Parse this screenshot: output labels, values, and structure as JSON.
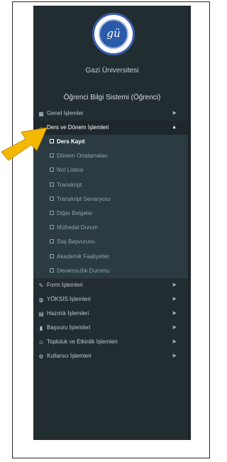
{
  "university": {
    "name": "Gazi Üniversitesi",
    "logo_monogram": "gü"
  },
  "panel_title": "Öğrenci Bilgi Sistemi (Öğrenci)",
  "colors": {
    "sidebar_bg": "#222d32",
    "submenu_bg": "#2c3b41",
    "arrow": "#f5b800"
  },
  "menu": [
    {
      "label": "Genel İşlemler",
      "icon": "table-icon",
      "expanded": false
    },
    {
      "label": "Ders ve Dönem İşlemleri",
      "icon": "bank-icon",
      "expanded": true,
      "children": [
        "Ders Kayıt",
        "Dönem Ortalamaları",
        "Not Listesi",
        "Transkript",
        "Transkript Senaryosu",
        "Diğer Belgeler",
        "Müfredat Durum",
        "Staj Başvurusu",
        "Akademik Faaliyetler",
        "Devamsızlık Durumu"
      ],
      "active_child": "Ders Kayıt"
    },
    {
      "label": "Form İşlemleri",
      "icon": "form-icon",
      "expanded": false
    },
    {
      "label": "YÖKSİS İşlemleri",
      "icon": "globe-icon",
      "expanded": false
    },
    {
      "label": "Hazırlık İşlemleri",
      "icon": "keyboard-icon",
      "expanded": false
    },
    {
      "label": "Başvuru İşlemleri",
      "icon": "document-icon",
      "expanded": false
    },
    {
      "label": "Topluluk ve Etkinlik İşlemleri",
      "icon": "users-icon",
      "expanded": false
    },
    {
      "label": "Kullanıcı İşlemleri",
      "icon": "user-cog-icon",
      "expanded": false
    }
  ]
}
